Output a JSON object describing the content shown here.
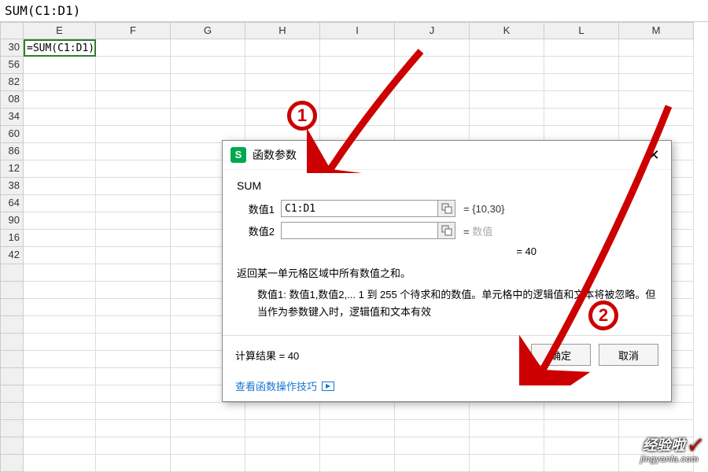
{
  "formula_bar": "SUM(C1:D1)",
  "columns": [
    "E",
    "F",
    "G",
    "H",
    "I",
    "J",
    "K",
    "L",
    "M"
  ],
  "rows": [
    {
      "num": "30",
      "content": "=SUM(C1:D1)"
    },
    {
      "num": "56"
    },
    {
      "num": "82"
    },
    {
      "num": "08"
    },
    {
      "num": "34"
    },
    {
      "num": "60"
    },
    {
      "num": "86"
    },
    {
      "num": "12"
    },
    {
      "num": "38"
    },
    {
      "num": "64"
    },
    {
      "num": "90"
    },
    {
      "num": "16"
    },
    {
      "num": "42"
    }
  ],
  "dialog": {
    "icon_letter": "S",
    "title": "函数参数",
    "func_name": "SUM",
    "args": [
      {
        "label": "数值1",
        "value": "C1:D1",
        "result": "= {10,30}"
      },
      {
        "label": "数值2",
        "value": "",
        "result": "= ",
        "placeholder": "数值"
      }
    ],
    "total": "= 40",
    "description": "返回某一单元格区域中所有数值之和。",
    "arg_detail_label": "数值1:",
    "arg_detail": "数值1,数值2,... 1 到 255 个待求和的数值。单元格中的逻辑值和文本将被忽略。但当作为参数键入时，逻辑值和文本有效",
    "calc_result": "计算结果 = 40",
    "help_link": "查看函数操作技巧",
    "ok": "确定",
    "cancel": "取消"
  },
  "callouts": {
    "one": "1",
    "two": "2"
  },
  "watermark": {
    "main": "经验啦",
    "check": "✓",
    "sub": "jingyanla.com"
  }
}
